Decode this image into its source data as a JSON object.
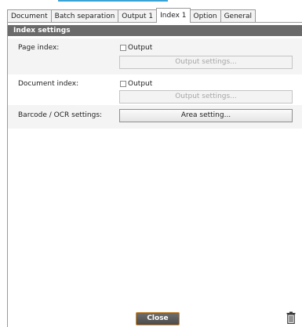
{
  "tabs": [
    {
      "label": "Document",
      "active": false
    },
    {
      "label": "Batch separation",
      "active": false
    },
    {
      "label": "Output 1",
      "active": false
    },
    {
      "label": "Index 1",
      "active": true
    },
    {
      "label": "Option",
      "active": false
    },
    {
      "label": "General",
      "active": false
    }
  ],
  "section": {
    "title": "Index settings"
  },
  "page_index": {
    "label": "Page index:",
    "checkbox_label": "Output",
    "checked": false,
    "button_label": "Output settings...",
    "button_enabled": false
  },
  "document_index": {
    "label": "Document index:",
    "checkbox_label": "Output",
    "checked": false,
    "button_label": "Output settings...",
    "button_enabled": false
  },
  "barcode_ocr": {
    "label": "Barcode / OCR settings:",
    "button_label": "Area setting...",
    "button_enabled": true
  },
  "footer": {
    "close_label": "Close",
    "trash_icon": "trash-icon"
  },
  "colors": {
    "header_bg": "#6a6a6a",
    "close_border": "#d48a2e",
    "accent": "#3aa3d6"
  }
}
